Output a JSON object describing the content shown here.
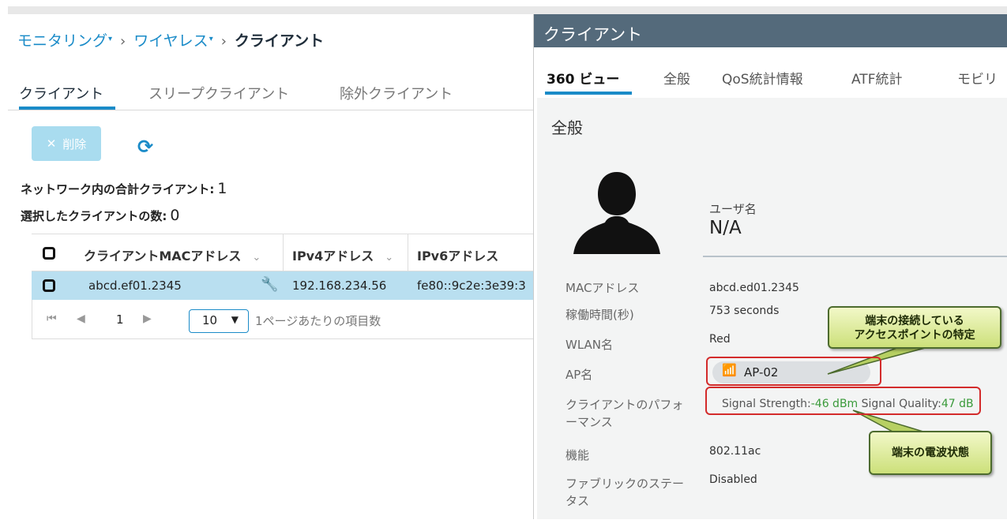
{
  "breadcrumb": {
    "item1": "モニタリング",
    "item2": "ワイヤレス",
    "current": "クライアント"
  },
  "left_tabs": [
    "クライアント",
    "スリープクライアント",
    "除外クライアント"
  ],
  "toolbar": {
    "delete_label": "削除"
  },
  "stats": {
    "total_label": "ネットワーク内の合計クライアント:",
    "total_value": "1",
    "selected_label": "選択したクライアントの数:",
    "selected_value": "0"
  },
  "table": {
    "columns": [
      "クライアントMACアドレス",
      "IPv4アドレス",
      "IPv6アドレス"
    ],
    "rows": [
      {
        "mac": "abcd.ef01.2345",
        "ipv4": "192.168.234.56",
        "ipv6": "fe80::9c2e:3e39:3"
      }
    ],
    "pager": {
      "page": "1",
      "per_page": "10",
      "per_page_label": "1ページあたりの項目数"
    }
  },
  "detail": {
    "title": "クライアント",
    "tabs": [
      "360 ビュー",
      "全般",
      "QoS統計情報",
      "ATF統計",
      "モビリ"
    ],
    "section": "全般",
    "username_label": "ユーザ名",
    "username_value": "N/A",
    "fields": {
      "mac_label": "MACアドレス",
      "mac_value": "abcd.ed01.2345",
      "uptime_label": "稼働時間(秒)",
      "uptime_value": "753 seconds",
      "wlan_label": "WLAN名",
      "wlan_value": "Red",
      "ap_label": "AP名",
      "ap_value": "AP-02",
      "perf_label": "クライアントのパフォーマンス",
      "perf_signal_strength_label": "Signal Strength:",
      "perf_signal_strength_value": "-46 dBm",
      "perf_signal_quality_label": "Signal Quality:",
      "perf_signal_quality_value": "47 dB",
      "capability_label": "機能",
      "capability_value": "802.11ac",
      "fabric_label": "ファブリックのステータス",
      "fabric_value": "Disabled"
    }
  },
  "annotations": {
    "ap_callout_line1": "端末の接続している",
    "ap_callout_line2": "アクセスポイントの特定",
    "signal_callout": "端末の電波状態"
  },
  "colors": {
    "accent": "#1a8bc8",
    "header_bg": "#546a7b",
    "selected_row": "#b9dff0",
    "highlight_border": "#d32b2b",
    "callout_fill": "#cce07a"
  }
}
